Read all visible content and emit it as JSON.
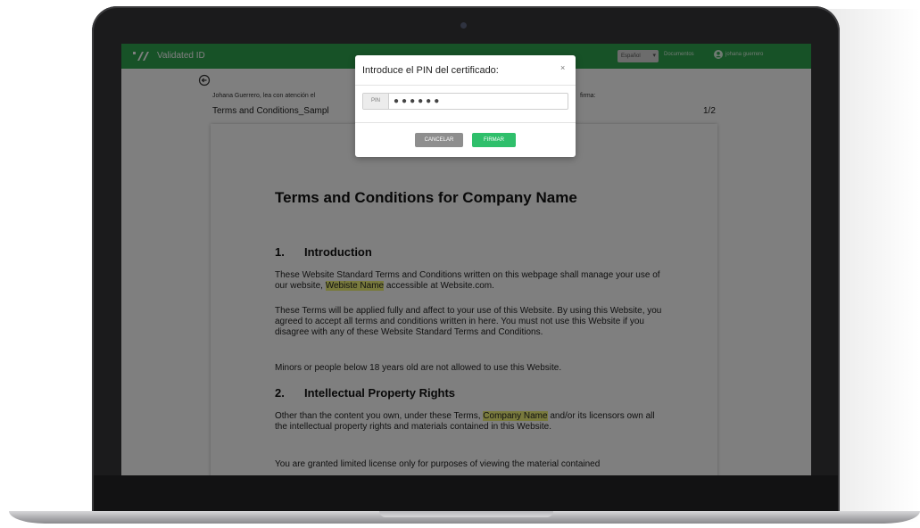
{
  "header": {
    "logo_text": "Validated ID",
    "language": "Español",
    "documents_link": "Documentos",
    "user_name": "johana guerrero"
  },
  "document_view": {
    "instructions": "Johana Guerrero, lea con atención el",
    "instructions_end": "firma:",
    "document_name": "Terms and Conditions_Sampl",
    "page_indicator": "1/2"
  },
  "document": {
    "title": "Terms and Conditions for Company Name",
    "section1": {
      "number": "1.",
      "heading": "Introduction"
    },
    "para1": {
      "before": "These Website Standard Terms and Conditions written on this webpage shall manage your use of our website, ",
      "highlight": "Webiste Name",
      "after": " accessible at ",
      "link": "Website.com"
    },
    "para2": "These Terms will be applied fully and affect to your use of this Website. By using this Website, you agreed to accept all terms and conditions written in here. You must not use this Website if you disagree with any of these Website Standard Terms and Conditions.",
    "para3": "Minors or people below 18 years old are not allowed to use this Website.",
    "section2": {
      "number": "2.",
      "heading": "Intellectual Property Rights"
    },
    "para4": {
      "before": "Other than the content you own, under these Terms, ",
      "highlight": "Company Name",
      "after": " and/or its licensors own all the intellectual property rights and materials contained in this Website."
    },
    "para5": "You are granted limited license only for purposes of viewing the material contained"
  },
  "modal": {
    "title": "Introduce el PIN del certificado:",
    "close": "×",
    "pin_label": "PIN",
    "pin_value": "●●●●●●",
    "cancel_label": "CANCELAR",
    "sign_label": "FIRMAR"
  },
  "colors": {
    "brand_green": "#2ea44f",
    "sign_button": "#2fbf6b",
    "cancel_button": "#8e8e8e"
  }
}
